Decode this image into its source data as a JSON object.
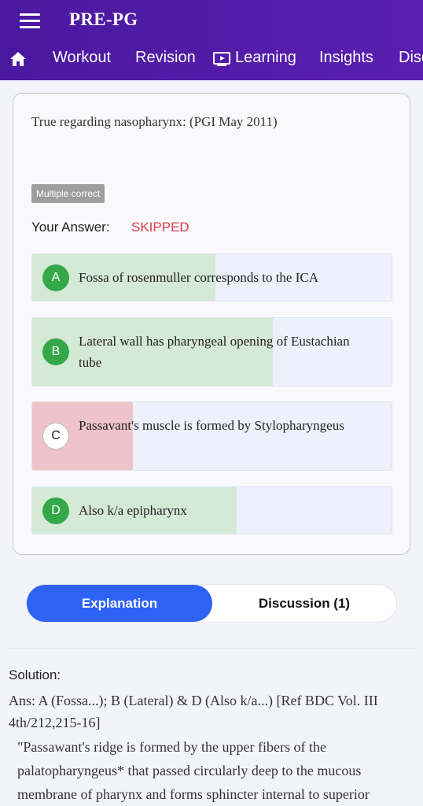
{
  "app": {
    "title": "PRE-PG"
  },
  "nav": {
    "items": [
      {
        "label": "Workout"
      },
      {
        "label": "Revision"
      },
      {
        "label": "Learning"
      },
      {
        "label": "Insights"
      },
      {
        "label": "Discuss"
      }
    ]
  },
  "question": {
    "text": "True regarding nasopharynx: (PGI May 2011)",
    "badge": "Multiple correct",
    "answer_label": "Your Answer:",
    "answer_value": "SKIPPED",
    "options": [
      {
        "letter": "A",
        "text": "Fossa of rosenmuller corresponds to the ICA",
        "status": "correct",
        "share": 0.51
      },
      {
        "letter": "B",
        "text": "Lateral wall has pharyngeal opening of Eustachian tube",
        "status": "correct",
        "share": 0.67
      },
      {
        "letter": "C",
        "text": "Passavant's muscle is formed by Stylopharyngeus",
        "status": "incorrect",
        "share": 0.28
      },
      {
        "letter": "D",
        "text": "Also k/a epipharynx",
        "status": "correct",
        "share": 0.57
      }
    ]
  },
  "tabs": {
    "explanation": "Explanation",
    "discussion": "Discussion (1)"
  },
  "solution": {
    "label": "Solution:",
    "answer": "Ans: A (Fossa...); B (Lateral) & D (Also k/a...) [Ref BDC Vol. III 4th/212,215-16]",
    "quote": "\"Passawant's ridge is formed by the upper fibers of the palatopharyngeus* that passed circularly deep to the mucous membrane of pharynx and forms sphincter internal to superior"
  },
  "colors": {
    "appbar": "#4a189f",
    "correct_fill": "#d4e9d6",
    "incorrect_fill": "#eec3c9",
    "correct_circle": "#35a84a",
    "accent": "#2d62f4",
    "skipped": "#e03c4c"
  }
}
